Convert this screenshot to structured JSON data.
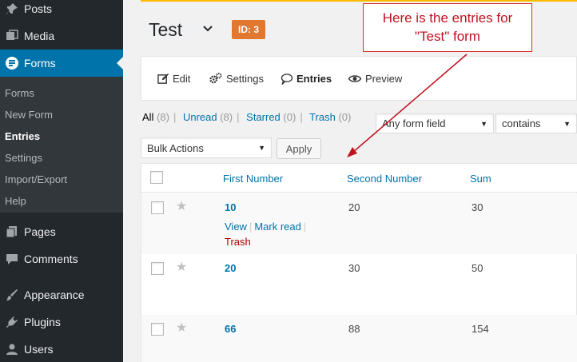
{
  "sidebar": {
    "items": [
      {
        "label": "Posts",
        "icon": "pin-icon"
      },
      {
        "label": "Media",
        "icon": "media-icon"
      },
      {
        "label": "Forms",
        "icon": "forms-icon"
      },
      {
        "label": "Pages",
        "icon": "pages-icon"
      },
      {
        "label": "Comments",
        "icon": "comments-icon"
      },
      {
        "label": "Appearance",
        "icon": "brush-icon"
      },
      {
        "label": "Plugins",
        "icon": "plug-icon"
      },
      {
        "label": "Users",
        "icon": "user-icon"
      }
    ],
    "submenu": [
      "Forms",
      "New Form",
      "Entries",
      "Settings",
      "Import/Export",
      "Help"
    ]
  },
  "header": {
    "title": "Test",
    "id_badge": "ID: 3"
  },
  "callout": {
    "line1": "Here is the entries for",
    "line2": "\"Test\" form"
  },
  "toolbar": {
    "edit": "Edit",
    "settings": "Settings",
    "entries": "Entries",
    "preview": "Preview"
  },
  "filters": {
    "all": "All",
    "all_count": "(8)",
    "unread": "Unread",
    "unread_count": "(8)",
    "starred": "Starred",
    "starred_count": "(0)",
    "trash": "Trash",
    "trash_count": "(0)",
    "field_select": "Any form field",
    "operator_select": "contains",
    "bulk_actions": "Bulk Actions",
    "apply": "Apply"
  },
  "table": {
    "columns": [
      "First Number",
      "Second Number",
      "Sum"
    ],
    "rows": [
      {
        "first": "10",
        "second": "20",
        "sum": "30"
      },
      {
        "first": "20",
        "second": "30",
        "sum": "50"
      },
      {
        "first": "66",
        "second": "88",
        "sum": "154"
      }
    ],
    "row_actions": {
      "view": "View",
      "mark_read": "Mark read",
      "trash": "Trash"
    }
  },
  "colors": {
    "sidebar_bg": "#23282d",
    "active_blue": "#0073aa",
    "badge_orange": "#e27730",
    "callout_red": "#c0111f"
  }
}
